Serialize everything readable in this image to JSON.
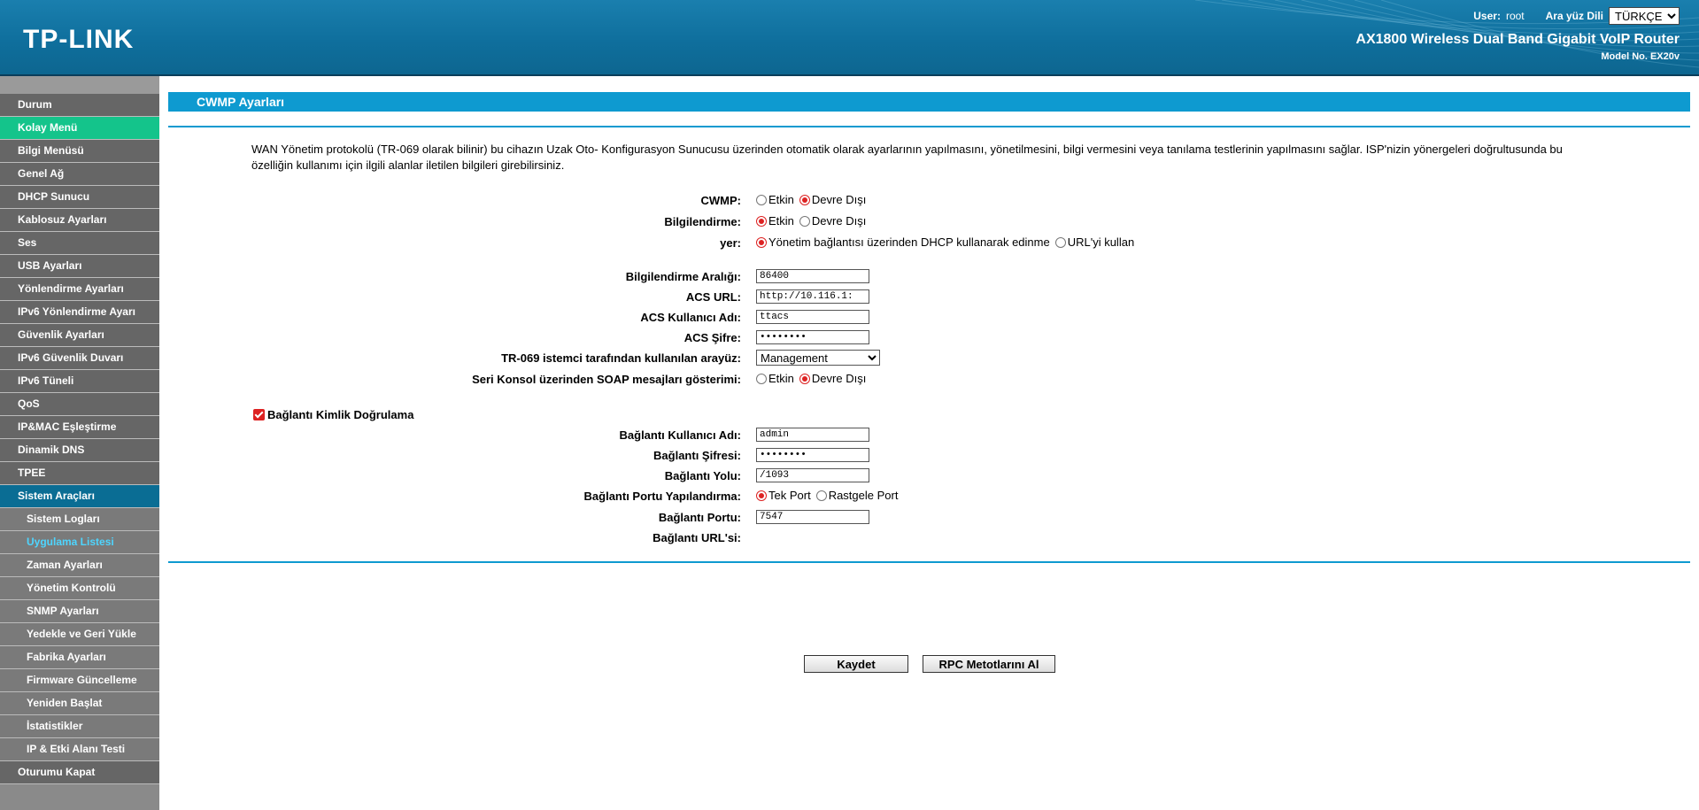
{
  "header": {
    "logo": "TP-LINK",
    "user_label": "User:",
    "user_value": "root",
    "lang_label": "Ara yüz Dili",
    "lang_selected": "TÜRKÇE",
    "product": "AX1800 Wireless Dual Band Gigabit VoIP Router",
    "model": "Model No. EX20v"
  },
  "sidebar": {
    "items": [
      {
        "label": "Durum"
      },
      {
        "label": "Kolay Menü"
      },
      {
        "label": "Bilgi Menüsü"
      },
      {
        "label": "Genel Ağ"
      },
      {
        "label": "DHCP Sunucu"
      },
      {
        "label": "Kablosuz Ayarları"
      },
      {
        "label": "Ses"
      },
      {
        "label": "USB Ayarları"
      },
      {
        "label": "Yönlendirme Ayarları"
      },
      {
        "label": "IPv6 Yönlendirme Ayarı"
      },
      {
        "label": "Güvenlik Ayarları"
      },
      {
        "label": "IPv6 Güvenlik Duvarı"
      },
      {
        "label": "IPv6 Tüneli"
      },
      {
        "label": "QoS"
      },
      {
        "label": "IP&MAC Eşleştirme"
      },
      {
        "label": "Dinamik DNS"
      },
      {
        "label": "TPEE"
      },
      {
        "label": "Sistem Araçları"
      },
      {
        "label": "Sistem Logları"
      },
      {
        "label": "Uygulama Listesi"
      },
      {
        "label": "Zaman Ayarları"
      },
      {
        "label": "Yönetim Kontrolü"
      },
      {
        "label": "SNMP Ayarları"
      },
      {
        "label": "Yedekle ve Geri Yükle"
      },
      {
        "label": "Fabrika Ayarları"
      },
      {
        "label": "Firmware Güncelleme"
      },
      {
        "label": "Yeniden Başlat"
      },
      {
        "label": "İstatistikler"
      },
      {
        "label": "IP & Etki Alanı Testi"
      },
      {
        "label": "Oturumu Kapat"
      }
    ]
  },
  "page": {
    "title": "CWMP Ayarları",
    "description": "WAN Yönetim protokolü (TR-069 olarak bilinir) bu cihazın Uzak Oto- Konfigurasyon Sunucusu üzerinden otomatik olarak ayarlarının yapılmasını, yönetilmesini, bilgi vermesini veya tanılama testlerinin yapılmasını sağlar. ISP'nizin yönergeleri doğrultusunda bu özelliğin kullanımı için ilgili alanlar iletilen bilgileri girebilirsiniz."
  },
  "form": {
    "cwmp": {
      "label": "CWMP:",
      "opt1": "Etkin",
      "opt2": "Devre Dışı",
      "selected": "Devre Dışı"
    },
    "inform": {
      "label": "Bilgilendirme:",
      "opt1": "Etkin",
      "opt2": "Devre Dışı",
      "selected": "Etkin"
    },
    "location": {
      "label": "yer:",
      "opt1": "Yönetim bağlantısı üzerinden DHCP kullanarak edinme",
      "opt2": "URL'yi kullan",
      "selected": "Yönetim bağlantısı üzerinden DHCP kullanarak edinme"
    },
    "inform_interval": {
      "label": "Bilgilendirme Aralığı:",
      "value": "86400"
    },
    "acs_url": {
      "label": "ACS URL:",
      "value": "http://10.116.1:"
    },
    "acs_user": {
      "label": "ACS Kullanıcı Adı:",
      "value": "ttacs"
    },
    "acs_pass": {
      "label": "ACS Şifre:",
      "value": "••••••••"
    },
    "interface": {
      "label": "TR-069 istemci tarafından kullanılan arayüz:",
      "value": "Management"
    },
    "soap": {
      "label": "Seri Konsol üzerinden SOAP mesajları gösterimi:",
      "opt1": "Etkin",
      "opt2": "Devre Dışı",
      "selected": "Devre Dışı"
    },
    "conn_auth": {
      "label": "Bağlantı Kimlik Doğrulama",
      "checked": true
    },
    "conn_user": {
      "label": "Bağlantı Kullanıcı Adı:",
      "value": "admin"
    },
    "conn_pass": {
      "label": "Bağlantı Şifresi:",
      "value": "••••••••"
    },
    "conn_path": {
      "label": "Bağlantı Yolu:",
      "value": "/1093"
    },
    "conn_port_cfg": {
      "label": "Bağlantı Portu Yapılandırma:",
      "opt1": "Tek Port",
      "opt2": "Rastgele Port",
      "selected": "Tek Port"
    },
    "conn_port": {
      "label": "Bağlantı Portu:",
      "value": "7547"
    },
    "conn_url": {
      "label": "Bağlantı URL'si:",
      "value": ""
    }
  },
  "buttons": {
    "save": "Kaydet",
    "rpc": "RPC Metotlarını Al"
  },
  "colors": {
    "header": "#0f6f9d",
    "accent": "#0e9ad0",
    "active_menu": "#14c48b",
    "open_menu": "#0a6d94",
    "radio_on": "#dd2222"
  }
}
